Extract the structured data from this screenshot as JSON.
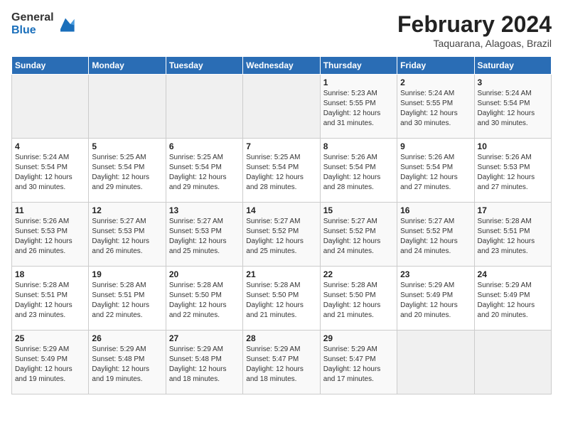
{
  "header": {
    "logo_line1": "General",
    "logo_line2": "Blue",
    "month_title": "February 2024",
    "location": "Taquarana, Alagoas, Brazil"
  },
  "calendar": {
    "days_of_week": [
      "Sunday",
      "Monday",
      "Tuesday",
      "Wednesday",
      "Thursday",
      "Friday",
      "Saturday"
    ],
    "weeks": [
      [
        {
          "day": "",
          "info": ""
        },
        {
          "day": "",
          "info": ""
        },
        {
          "day": "",
          "info": ""
        },
        {
          "day": "",
          "info": ""
        },
        {
          "day": "1",
          "info": "Sunrise: 5:23 AM\nSunset: 5:55 PM\nDaylight: 12 hours and 31 minutes."
        },
        {
          "day": "2",
          "info": "Sunrise: 5:24 AM\nSunset: 5:55 PM\nDaylight: 12 hours and 30 minutes."
        },
        {
          "day": "3",
          "info": "Sunrise: 5:24 AM\nSunset: 5:54 PM\nDaylight: 12 hours and 30 minutes."
        }
      ],
      [
        {
          "day": "4",
          "info": "Sunrise: 5:24 AM\nSunset: 5:54 PM\nDaylight: 12 hours and 30 minutes."
        },
        {
          "day": "5",
          "info": "Sunrise: 5:25 AM\nSunset: 5:54 PM\nDaylight: 12 hours and 29 minutes."
        },
        {
          "day": "6",
          "info": "Sunrise: 5:25 AM\nSunset: 5:54 PM\nDaylight: 12 hours and 29 minutes."
        },
        {
          "day": "7",
          "info": "Sunrise: 5:25 AM\nSunset: 5:54 PM\nDaylight: 12 hours and 28 minutes."
        },
        {
          "day": "8",
          "info": "Sunrise: 5:26 AM\nSunset: 5:54 PM\nDaylight: 12 hours and 28 minutes."
        },
        {
          "day": "9",
          "info": "Sunrise: 5:26 AM\nSunset: 5:54 PM\nDaylight: 12 hours and 27 minutes."
        },
        {
          "day": "10",
          "info": "Sunrise: 5:26 AM\nSunset: 5:53 PM\nDaylight: 12 hours and 27 minutes."
        }
      ],
      [
        {
          "day": "11",
          "info": "Sunrise: 5:26 AM\nSunset: 5:53 PM\nDaylight: 12 hours and 26 minutes."
        },
        {
          "day": "12",
          "info": "Sunrise: 5:27 AM\nSunset: 5:53 PM\nDaylight: 12 hours and 26 minutes."
        },
        {
          "day": "13",
          "info": "Sunrise: 5:27 AM\nSunset: 5:53 PM\nDaylight: 12 hours and 25 minutes."
        },
        {
          "day": "14",
          "info": "Sunrise: 5:27 AM\nSunset: 5:52 PM\nDaylight: 12 hours and 25 minutes."
        },
        {
          "day": "15",
          "info": "Sunrise: 5:27 AM\nSunset: 5:52 PM\nDaylight: 12 hours and 24 minutes."
        },
        {
          "day": "16",
          "info": "Sunrise: 5:27 AM\nSunset: 5:52 PM\nDaylight: 12 hours and 24 minutes."
        },
        {
          "day": "17",
          "info": "Sunrise: 5:28 AM\nSunset: 5:51 PM\nDaylight: 12 hours and 23 minutes."
        }
      ],
      [
        {
          "day": "18",
          "info": "Sunrise: 5:28 AM\nSunset: 5:51 PM\nDaylight: 12 hours and 23 minutes."
        },
        {
          "day": "19",
          "info": "Sunrise: 5:28 AM\nSunset: 5:51 PM\nDaylight: 12 hours and 22 minutes."
        },
        {
          "day": "20",
          "info": "Sunrise: 5:28 AM\nSunset: 5:50 PM\nDaylight: 12 hours and 22 minutes."
        },
        {
          "day": "21",
          "info": "Sunrise: 5:28 AM\nSunset: 5:50 PM\nDaylight: 12 hours and 21 minutes."
        },
        {
          "day": "22",
          "info": "Sunrise: 5:28 AM\nSunset: 5:50 PM\nDaylight: 12 hours and 21 minutes."
        },
        {
          "day": "23",
          "info": "Sunrise: 5:29 AM\nSunset: 5:49 PM\nDaylight: 12 hours and 20 minutes."
        },
        {
          "day": "24",
          "info": "Sunrise: 5:29 AM\nSunset: 5:49 PM\nDaylight: 12 hours and 20 minutes."
        }
      ],
      [
        {
          "day": "25",
          "info": "Sunrise: 5:29 AM\nSunset: 5:49 PM\nDaylight: 12 hours and 19 minutes."
        },
        {
          "day": "26",
          "info": "Sunrise: 5:29 AM\nSunset: 5:48 PM\nDaylight: 12 hours and 19 minutes."
        },
        {
          "day": "27",
          "info": "Sunrise: 5:29 AM\nSunset: 5:48 PM\nDaylight: 12 hours and 18 minutes."
        },
        {
          "day": "28",
          "info": "Sunrise: 5:29 AM\nSunset: 5:47 PM\nDaylight: 12 hours and 18 minutes."
        },
        {
          "day": "29",
          "info": "Sunrise: 5:29 AM\nSunset: 5:47 PM\nDaylight: 12 hours and 17 minutes."
        },
        {
          "day": "",
          "info": ""
        },
        {
          "day": "",
          "info": ""
        }
      ]
    ]
  }
}
